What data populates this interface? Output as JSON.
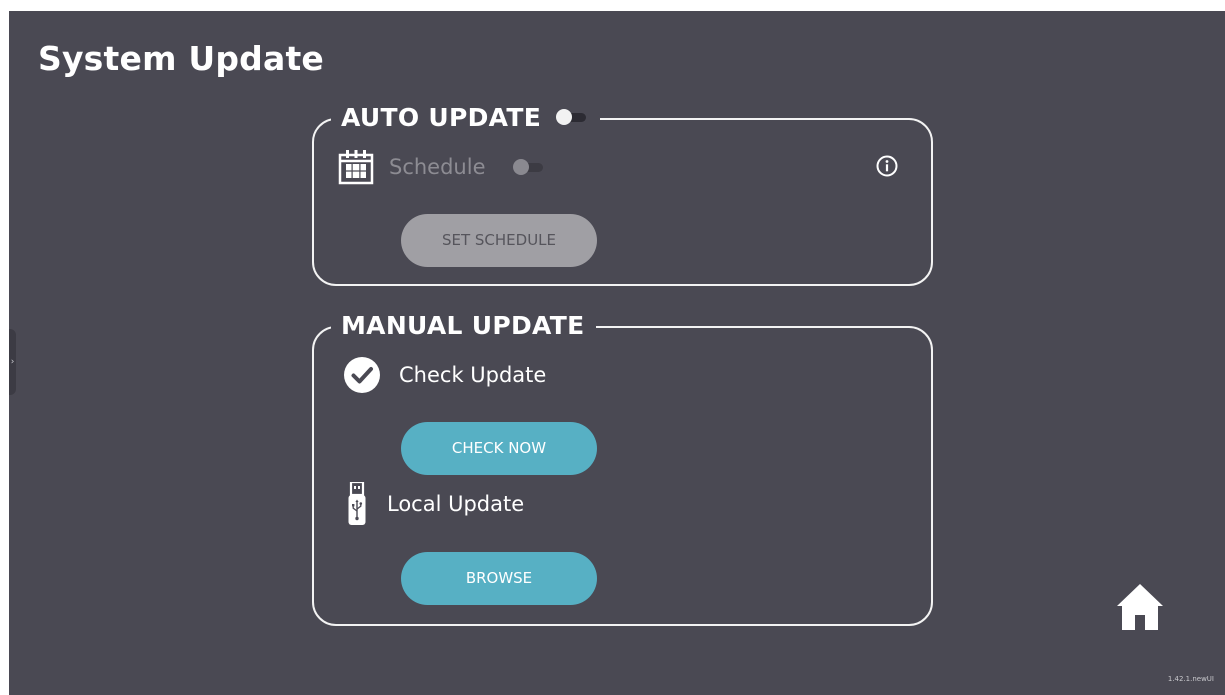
{
  "page": {
    "title": "System Update",
    "version": "1.42.1.newUI",
    "side_handle_icon": "chevron-right-icon",
    "home_icon": "home-icon"
  },
  "colors": {
    "background": "#4a4953",
    "accent_button": "#57b0c4",
    "disabled_button": "#a09fa4",
    "border": "#f3f3f3",
    "text": "#ffffff"
  },
  "auto_update": {
    "title": "AUTO UPDATE",
    "toggle": {
      "state": "off",
      "enabled": true
    },
    "schedule": {
      "icon": "calendar-icon",
      "label": "Schedule",
      "toggle": {
        "state": "off",
        "enabled": false
      }
    },
    "info_icon": "info-icon",
    "set_schedule_button": {
      "label": "SET SCHEDULE",
      "enabled": false
    }
  },
  "manual_update": {
    "title": "MANUAL UPDATE",
    "check_update": {
      "icon": "check-circle-icon",
      "label": "Check Update",
      "button": {
        "label": "CHECK NOW",
        "enabled": true
      }
    },
    "local_update": {
      "icon": "usb-drive-icon",
      "label": "Local Update",
      "button": {
        "label": "BROWSE",
        "enabled": true
      }
    }
  }
}
